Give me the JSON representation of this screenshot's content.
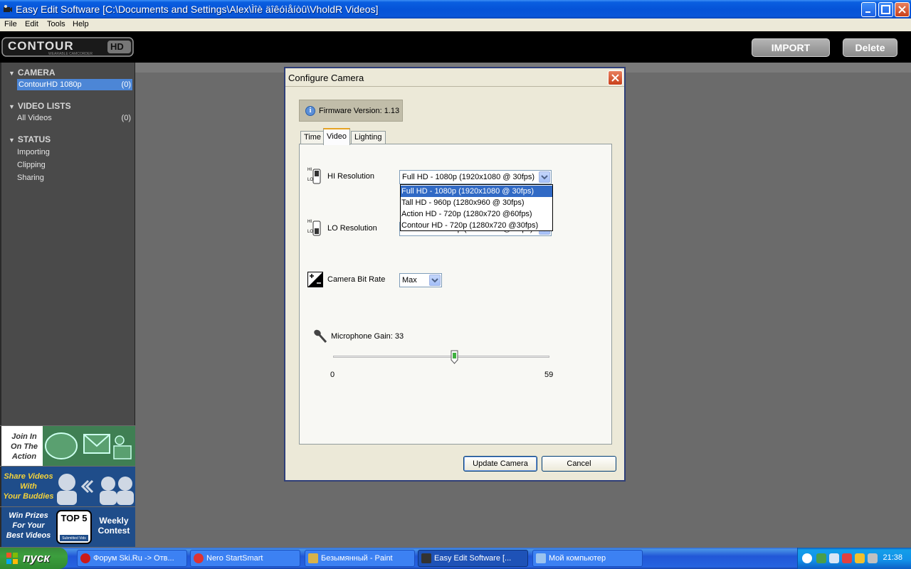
{
  "window": {
    "title": "Easy Edit Software [C:\\Documents and Settings\\Alex\\Ìîè äîêóìåíòû\\VholdR Videos]"
  },
  "menu": [
    "File",
    "Edit",
    "Tools",
    "Help"
  ],
  "header": {
    "logo_text": "CONTOUR",
    "logo_suffix": "HD",
    "logo_tagline": "WEARABLE CAMCORDER",
    "import_label": "IMPORT",
    "delete_label": "Delete"
  },
  "sidebar": {
    "camera": {
      "title": "CAMERA",
      "items": [
        {
          "label": "ContourHD 1080p",
          "count": "(0)"
        }
      ]
    },
    "video_lists": {
      "title": "VIDEO LISTS",
      "items": [
        {
          "label": "All Videos",
          "count": "(0)"
        }
      ]
    },
    "status": {
      "title": "STATUS",
      "items": [
        "Importing",
        "Clipping",
        "Sharing"
      ]
    }
  },
  "ads": {
    "ad1": {
      "text1": "Join In",
      "text2": "On The",
      "text3": "Action"
    },
    "ad2": {
      "text1": "Share Videos",
      "text2": "With",
      "text3": "Your Buddies"
    },
    "ad3": {
      "text1": "Win Prizes",
      "text2": "For Your",
      "text3": "Best Videos",
      "badge": "TOP 5",
      "badge_sub": "Submitted Vids",
      "right1": "Weekly",
      "right2": "Contest"
    }
  },
  "dialog": {
    "title": "Configure Camera",
    "firmware": "Firmware Version: 1.13",
    "tabs": [
      "Time",
      "Video",
      "Lighting"
    ],
    "active_tab": "Video",
    "hi_resolution": {
      "label": "HI Resolution",
      "value": "Full HD - 1080p (1920x1080 @ 30fps)"
    },
    "lo_resolution": {
      "label": "LO Resolution",
      "value": "Action HD - 720p (1280x720 @60fps)"
    },
    "dropdown_options": [
      "Full HD - 1080p (1920x1080 @ 30fps)",
      "Tall HD - 960p (1280x960 @ 30fps)",
      "Action HD - 720p (1280x720 @60fps)",
      "Contour HD - 720p (1280x720 @30fps)"
    ],
    "bitrate": {
      "label": "Camera Bit Rate",
      "value": "Max"
    },
    "mic": {
      "label": "Microphone Gain: 33",
      "min": "0",
      "max": "59",
      "value": 33,
      "range": [
        0,
        59
      ]
    },
    "hi_tag": "HI",
    "lo_tag": "LO",
    "update_label": "Update Camera",
    "cancel_label": "Cancel"
  },
  "taskbar": {
    "start_label": "пуск",
    "tasks": [
      "Форум Ski.Ru -> Отв...",
      "Nero StartSmart",
      "Безымянный - Paint",
      "Easy Edit Software [...",
      "Мой компьютер"
    ],
    "active_task_index": 3,
    "clock": "21:38"
  },
  "colors": {
    "accent_blue": "#316ac5",
    "sidebar_selected": "#4c86d6",
    "dialog_bg": "#ece9d8"
  }
}
